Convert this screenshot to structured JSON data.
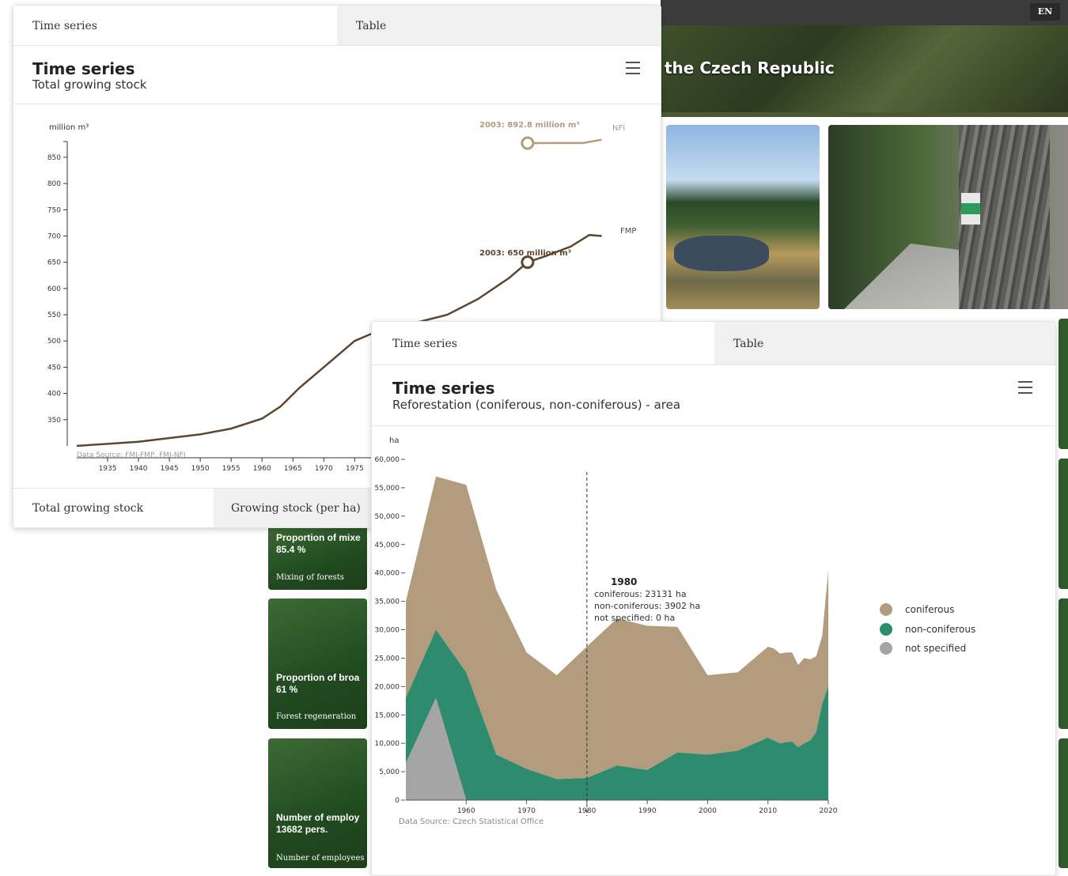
{
  "background_page": {
    "lang": "EN",
    "hero_title": "the Czech Republic",
    "cards": [
      {
        "title": "Proportion of mixe",
        "value": "85.4 %",
        "caption": "Mixing of forests"
      },
      {
        "title": "Proportion of broa",
        "value": "61 %",
        "caption": "Forest regeneration"
      },
      {
        "title": "Number of employ",
        "value": "13682 pers.",
        "caption": "Number of employees an"
      }
    ]
  },
  "panel1": {
    "tabs": [
      "Time series",
      "Table"
    ],
    "title": "Time series",
    "subtitle": "Total growing stock",
    "bottom_tabs": [
      "Total growing stock",
      "Growing stock (per ha)"
    ],
    "source": "Data Source: FMI-FMP, FMI-NFI",
    "unit": "million m³",
    "annotations": {
      "nfi": "2003: 892.8 million m³",
      "fmp": "2003: 650 million m³"
    },
    "colors": {
      "fmp": "#5c4632",
      "nfi": "#b39c7d"
    }
  },
  "panel2": {
    "tabs": [
      "Time series",
      "Table"
    ],
    "title": "Time series",
    "subtitle": "Reforestation (coniferous, non-coniferous) - area",
    "unit": "ha",
    "source": "Data Source: Czech Statistical Office",
    "tooltip": {
      "year": "1980",
      "lines": [
        "coniferous: 23131 ha",
        "non-coniferous: 3902 ha",
        "not specified: 0 ha"
      ]
    },
    "legend": [
      {
        "label": "coniferous",
        "color": "#b39c7d"
      },
      {
        "label": "non-coniferous",
        "color": "#2e8b6e"
      },
      {
        "label": "not specified",
        "color": "#a5a5a5"
      }
    ]
  },
  "chart_data": [
    {
      "type": "line",
      "title": "Time series",
      "subtitle": "Total growing stock",
      "ylabel": "million m³",
      "ylim": [
        300,
        880
      ],
      "y_ticks": [
        350,
        400,
        450,
        500,
        550,
        600,
        650,
        700,
        750,
        800,
        850
      ],
      "x_ticks": [
        1935,
        1940,
        1945,
        1950,
        1955,
        1960,
        1965,
        1970,
        1975
      ],
      "xlim": [
        1930,
        2018
      ],
      "series": [
        {
          "name": "FMP",
          "x": [
            1930,
            1940,
            1950,
            1955,
            1960,
            1963,
            1966,
            1970,
            1975,
            1980,
            1985,
            1990,
            1995,
            2000,
            2003,
            2006,
            2010,
            2013,
            2015
          ],
          "y": [
            300,
            308,
            322,
            333,
            352,
            375,
            410,
            450,
            500,
            525,
            535,
            550,
            580,
            620,
            650,
            662,
            680,
            702,
            700
          ]
        },
        {
          "name": "NFI",
          "x": [
            2003,
            2008,
            2012,
            2015
          ],
          "y": [
            892.8,
            893,
            893,
            900
          ]
        }
      ],
      "annotations": [
        "2003: 892.8 million m³",
        "2003: 650 million m³"
      ],
      "grid": false
    },
    {
      "type": "area",
      "title": "Time series",
      "subtitle": "Reforestation (coniferous, non-coniferous) - area",
      "ylabel": "ha",
      "ylim": [
        0,
        60000
      ],
      "y_ticks": [
        0,
        5000,
        10000,
        15000,
        20000,
        25000,
        30000,
        35000,
        40000,
        45000,
        50000,
        55000,
        60000
      ],
      "x_ticks": [
        1960,
        1970,
        1980,
        1990,
        2000,
        2010,
        2020
      ],
      "xlim": [
        1950,
        2020
      ],
      "x": [
        1950,
        1955,
        1960,
        1965,
        1970,
        1975,
        1980,
        1985,
        1990,
        1995,
        2000,
        2005,
        2010,
        2011,
        2012,
        2013,
        2014,
        2015,
        2016,
        2017,
        2018,
        2019,
        2020
      ],
      "stacked": true,
      "series": [
        {
          "name": "not specified",
          "values": [
            6500,
            18000,
            0,
            0,
            0,
            0,
            0,
            0,
            0,
            0,
            0,
            0,
            0,
            0,
            0,
            0,
            0,
            0,
            0,
            0,
            0,
            0,
            0
          ]
        },
        {
          "name": "non-coniferous",
          "values": [
            11500,
            12000,
            22500,
            8000,
            5500,
            3700,
            3902,
            6100,
            5300,
            8400,
            8000,
            8700,
            11000,
            10500,
            10000,
            10200,
            10300,
            9300,
            10000,
            10500,
            12000,
            17000,
            20000
          ]
        },
        {
          "name": "coniferous",
          "values": [
            17000,
            27000,
            33000,
            29000,
            20500,
            18300,
            23131,
            25900,
            25400,
            22100,
            14000,
            13800,
            16000,
            16200,
            15800,
            15800,
            15700,
            14500,
            15000,
            14300,
            13300,
            12000,
            20500
          ]
        }
      ],
      "tooltip": {
        "x": 1980,
        "coniferous": 23131,
        "non-coniferous": 3902,
        "not specified": 0
      },
      "grid": false,
      "legend": "right"
    }
  ]
}
